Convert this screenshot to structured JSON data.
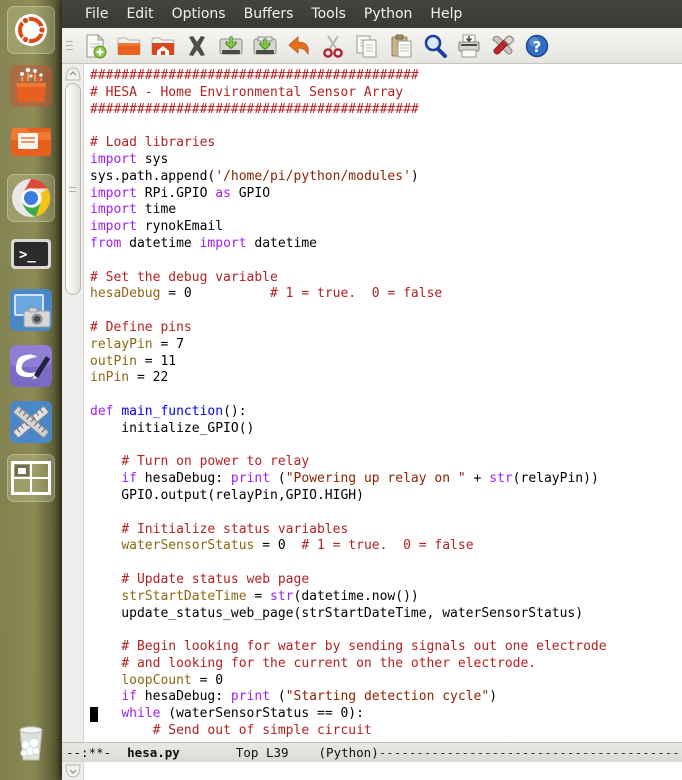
{
  "window": {
    "title": "hesa.py",
    "app": "emacs"
  },
  "menubar": {
    "items": [
      {
        "label": "File",
        "name": "menu-file"
      },
      {
        "label": "Edit",
        "name": "menu-edit"
      },
      {
        "label": "Options",
        "name": "menu-options"
      },
      {
        "label": "Buffers",
        "name": "menu-buffers"
      },
      {
        "label": "Tools",
        "name": "menu-tools"
      },
      {
        "label": "Python",
        "name": "menu-python"
      },
      {
        "label": "Help",
        "name": "menu-help"
      }
    ]
  },
  "toolbar": {
    "buttons": [
      {
        "name": "new-file-icon",
        "title": "New File"
      },
      {
        "name": "open-file-icon",
        "title": "Open File"
      },
      {
        "name": "open-home-folder-icon",
        "title": "Open Home Directory"
      },
      {
        "name": "close-buffer-icon",
        "title": "Close Buffer"
      },
      {
        "name": "save-icon",
        "title": "Save Buffer"
      },
      {
        "name": "save-as-icon",
        "title": "Write File"
      },
      {
        "name": "undo-icon",
        "title": "Undo"
      },
      {
        "name": "cut-icon",
        "title": "Cut"
      },
      {
        "name": "copy-icon",
        "title": "Copy"
      },
      {
        "name": "paste-icon",
        "title": "Paste"
      },
      {
        "name": "search-icon",
        "title": "Search"
      },
      {
        "name": "print-icon",
        "title": "Print Buffer"
      },
      {
        "name": "customize-tools-icon",
        "title": "Customize"
      },
      {
        "name": "help-icon",
        "title": "Help"
      }
    ]
  },
  "launcher": {
    "items": [
      {
        "name": "ubuntu-dash-icon",
        "label": "Dash Home",
        "active": false
      },
      {
        "name": "software-center-icon",
        "label": "Ubuntu Software Center",
        "active": false
      },
      {
        "name": "files-icon",
        "label": "Files",
        "active": false
      },
      {
        "name": "chrome-icon",
        "label": "Google Chrome",
        "active": true
      },
      {
        "name": "terminal-icon",
        "label": "Terminal",
        "active": false
      },
      {
        "name": "screenshot-icon",
        "label": "Screenshot",
        "active": false
      },
      {
        "name": "emacs-icon",
        "label": "GNU Emacs",
        "active": true
      },
      {
        "name": "measure-tools-icon",
        "label": "Rulers",
        "active": false
      },
      {
        "name": "workspace-switcher-icon",
        "label": "Workspace Switcher",
        "active": false
      },
      {
        "name": "trash-icon",
        "label": "Trash",
        "active": false
      }
    ]
  },
  "modeline": {
    "status": "--:**-",
    "buffer_name": "hesa.py",
    "position": "Top L39",
    "major_mode": "(Python)",
    "filler": "----------------------------------------"
  },
  "editor": {
    "cursor_line": 39,
    "scroll_position": "Top",
    "code_lines": [
      "##########################################",
      "# HESA - Home Environmental Sensor Array",
      "##########################################",
      "",
      "# Load libraries",
      "import sys",
      "sys.path.append('/home/pi/python/modules')",
      "import RPi.GPIO as GPIO",
      "import time",
      "import rynokEmail",
      "from datetime import datetime",
      "",
      "# Set the debug variable",
      "hesaDebug = 0          # 1 = true.  0 = false",
      "",
      "# Define pins",
      "relayPin = 7",
      "outPin = 11",
      "inPin = 22",
      "",
      "def main_function():",
      "    initialize_GPIO()",
      "",
      "    # Turn on power to relay",
      "    if hesaDebug: print (\"Powering up relay on \" + str(relayPin))",
      "    GPIO.output(relayPin,GPIO.HIGH)",
      "",
      "    # Initialize status variables",
      "    waterSensorStatus = 0  # 1 = true.  0 = false",
      "",
      "    # Update status web page",
      "    strStartDateTime = str(datetime.now())",
      "    update_status_web_page(strStartDateTime, waterSensorStatus)",
      "",
      "    # Begin looking for water by sending signals out one electrode",
      "    # and looking for the current on the other electrode.",
      "    loopCount = 0",
      "    if hesaDebug: print (\"Starting detection cycle\")",
      "    while (waterSensorStatus == 0):",
      "        # Send out of simple circuit"
    ]
  },
  "colors": {
    "comment": "#b22222",
    "keyword": "#a020f0",
    "string": "#8b2500",
    "function": "#0000ff",
    "variable": "#8b6914",
    "menubar_bg": "#3f3e39",
    "desktop_bg": "#8f8f53",
    "editor_bg": "#ffffff"
  }
}
